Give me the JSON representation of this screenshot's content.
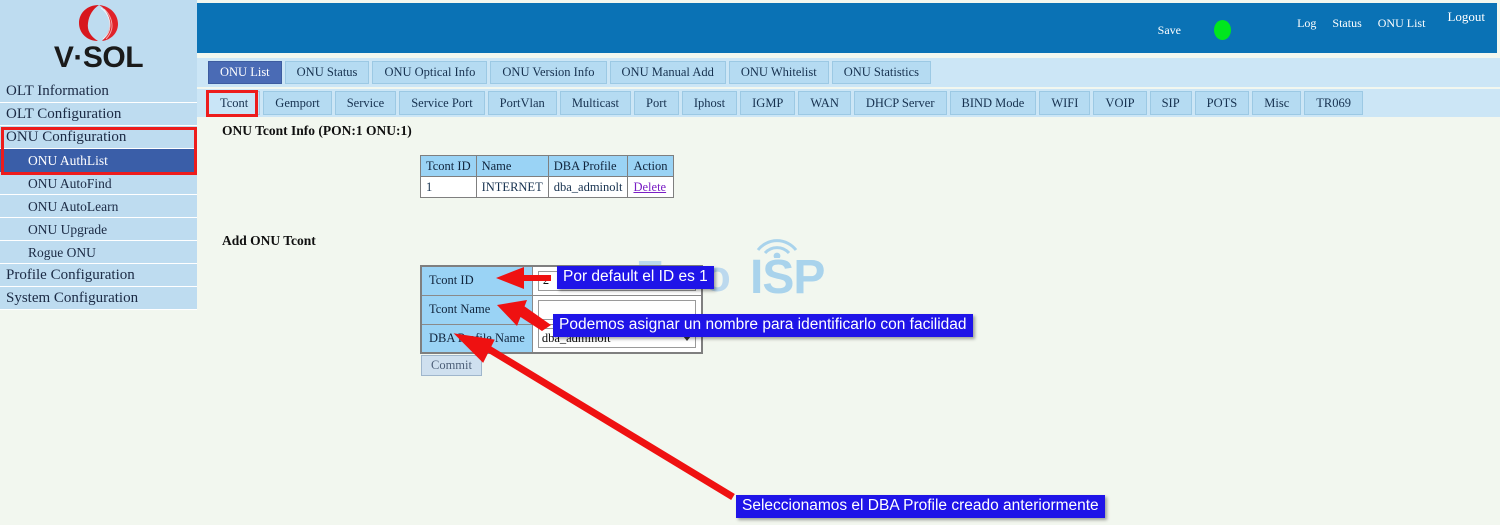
{
  "brand": {
    "logo_text": "V·SOL",
    "logo_icon": "vsol-swoosh-icon"
  },
  "header": {
    "save_label": "Save",
    "status_dot_color": "#00e61e",
    "links": [
      {
        "label": "Log"
      },
      {
        "label": "Status"
      },
      {
        "label": "ONU List"
      },
      {
        "label": "Logout"
      }
    ]
  },
  "sidebar": {
    "items": [
      {
        "label": "OLT Information",
        "level": 0,
        "selected": false
      },
      {
        "label": "OLT Configuration",
        "level": 0,
        "selected": false
      },
      {
        "label": "ONU Configuration",
        "level": 0,
        "selected": false
      },
      {
        "label": "ONU AuthList",
        "level": 1,
        "selected": true
      },
      {
        "label": "ONU AutoFind",
        "level": 1,
        "selected": false
      },
      {
        "label": "ONU AutoLearn",
        "level": 1,
        "selected": false
      },
      {
        "label": "ONU Upgrade",
        "level": 1,
        "selected": false
      },
      {
        "label": "Rogue ONU",
        "level": 1,
        "selected": false
      },
      {
        "label": "Profile Configuration",
        "level": 0,
        "selected": false
      },
      {
        "label": "System Configuration",
        "level": 0,
        "selected": false
      }
    ]
  },
  "tabs_primary": [
    {
      "label": "ONU List",
      "active": true
    },
    {
      "label": "ONU Status",
      "active": false
    },
    {
      "label": "ONU Optical Info",
      "active": false
    },
    {
      "label": "ONU Version Info",
      "active": false
    },
    {
      "label": "ONU Manual Add",
      "active": false
    },
    {
      "label": "ONU Whitelist",
      "active": false
    },
    {
      "label": "ONU Statistics",
      "active": false
    }
  ],
  "tabs_secondary": [
    {
      "label": "Tcont",
      "active": true
    },
    {
      "label": "Gemport",
      "active": false
    },
    {
      "label": "Service",
      "active": false
    },
    {
      "label": "Service Port",
      "active": false
    },
    {
      "label": "PortVlan",
      "active": false
    },
    {
      "label": "Multicast",
      "active": false
    },
    {
      "label": "Port",
      "active": false
    },
    {
      "label": "Iphost",
      "active": false
    },
    {
      "label": "IGMP",
      "active": false
    },
    {
      "label": "WAN",
      "active": false
    },
    {
      "label": "DHCP Server",
      "active": false
    },
    {
      "label": "BIND Mode",
      "active": false
    },
    {
      "label": "WIFI",
      "active": false
    },
    {
      "label": "VOIP",
      "active": false
    },
    {
      "label": "SIP",
      "active": false
    },
    {
      "label": "POTS",
      "active": false
    },
    {
      "label": "Misc",
      "active": false
    },
    {
      "label": "TR069",
      "active": false
    }
  ],
  "info_section": {
    "title": "ONU Tcont Info (PON:1 ONU:1)",
    "columns": [
      "Tcont ID",
      "Name",
      "DBA Profile",
      "Action"
    ],
    "rows": [
      {
        "tcont_id": "1",
        "name": "INTERNET",
        "dba_profile": "dba_adminolt",
        "action": "Delete"
      }
    ]
  },
  "add_section": {
    "title": "Add ONU Tcont",
    "fields": [
      {
        "label": "Tcont ID",
        "value": "2",
        "placeholder": "",
        "type": "text"
      },
      {
        "label": "Tcont Name",
        "value": "",
        "placeholder": "",
        "type": "text"
      },
      {
        "label": "DBA Profile Name",
        "value": "dba_adminolt",
        "placeholder": "",
        "type": "select",
        "options": [
          "dba_adminolt"
        ]
      }
    ],
    "commit_label": "Commit"
  },
  "watermark": {
    "text_primary": "Foro",
    "text_secondary": "ISP",
    "icon": "wifi-tower-icon"
  },
  "annotations": [
    {
      "id": "anno1",
      "text": "Por default el ID es 1"
    },
    {
      "id": "anno2",
      "text": "Podemos asignar un nombre para identificarlo con facilidad"
    },
    {
      "id": "anno3",
      "text": "Seleccionamos el DBA Profile creado anteriormente"
    }
  ],
  "highlight_color": "#ed1c1c",
  "annotation_bg_color": "#1f14e8"
}
